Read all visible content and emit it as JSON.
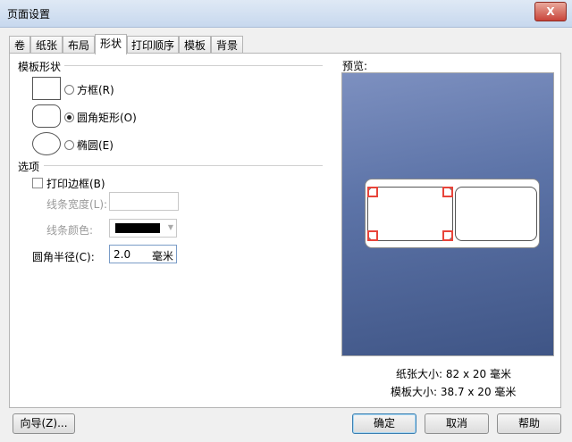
{
  "window": {
    "title": "页面设置",
    "close": "X"
  },
  "tabs": [
    {
      "label": "卷"
    },
    {
      "label": "纸张"
    },
    {
      "label": "布局"
    },
    {
      "label": "形状"
    },
    {
      "label": "打印顺序"
    },
    {
      "label": "模板"
    },
    {
      "label": "背景"
    }
  ],
  "active_tab": "形状",
  "template_shape": {
    "title": "模板形状",
    "options": [
      {
        "label": "方框(R)",
        "selected": false
      },
      {
        "label": "圆角矩形(O)",
        "selected": true
      },
      {
        "label": "椭圆(E)",
        "selected": false
      }
    ]
  },
  "options_group": {
    "title": "选项",
    "print_border": {
      "label": "打印边框(B)",
      "checked": false
    },
    "line_width": {
      "label": "线条宽度(L):",
      "value": ""
    },
    "line_color": {
      "label": "线条颜色:",
      "value": "#000000"
    },
    "corner_radius": {
      "label": "圆角半径(C):",
      "value": "2.0",
      "unit": "毫米"
    }
  },
  "preview": {
    "title": "预览:",
    "paper_size": "纸张大小: 82 x 20 毫米",
    "template_size": "模板大小: 38.7 x 20 毫米"
  },
  "buttons": {
    "wizard": "向导(Z)...",
    "ok": "确定",
    "cancel": "取消",
    "help": "帮助"
  }
}
